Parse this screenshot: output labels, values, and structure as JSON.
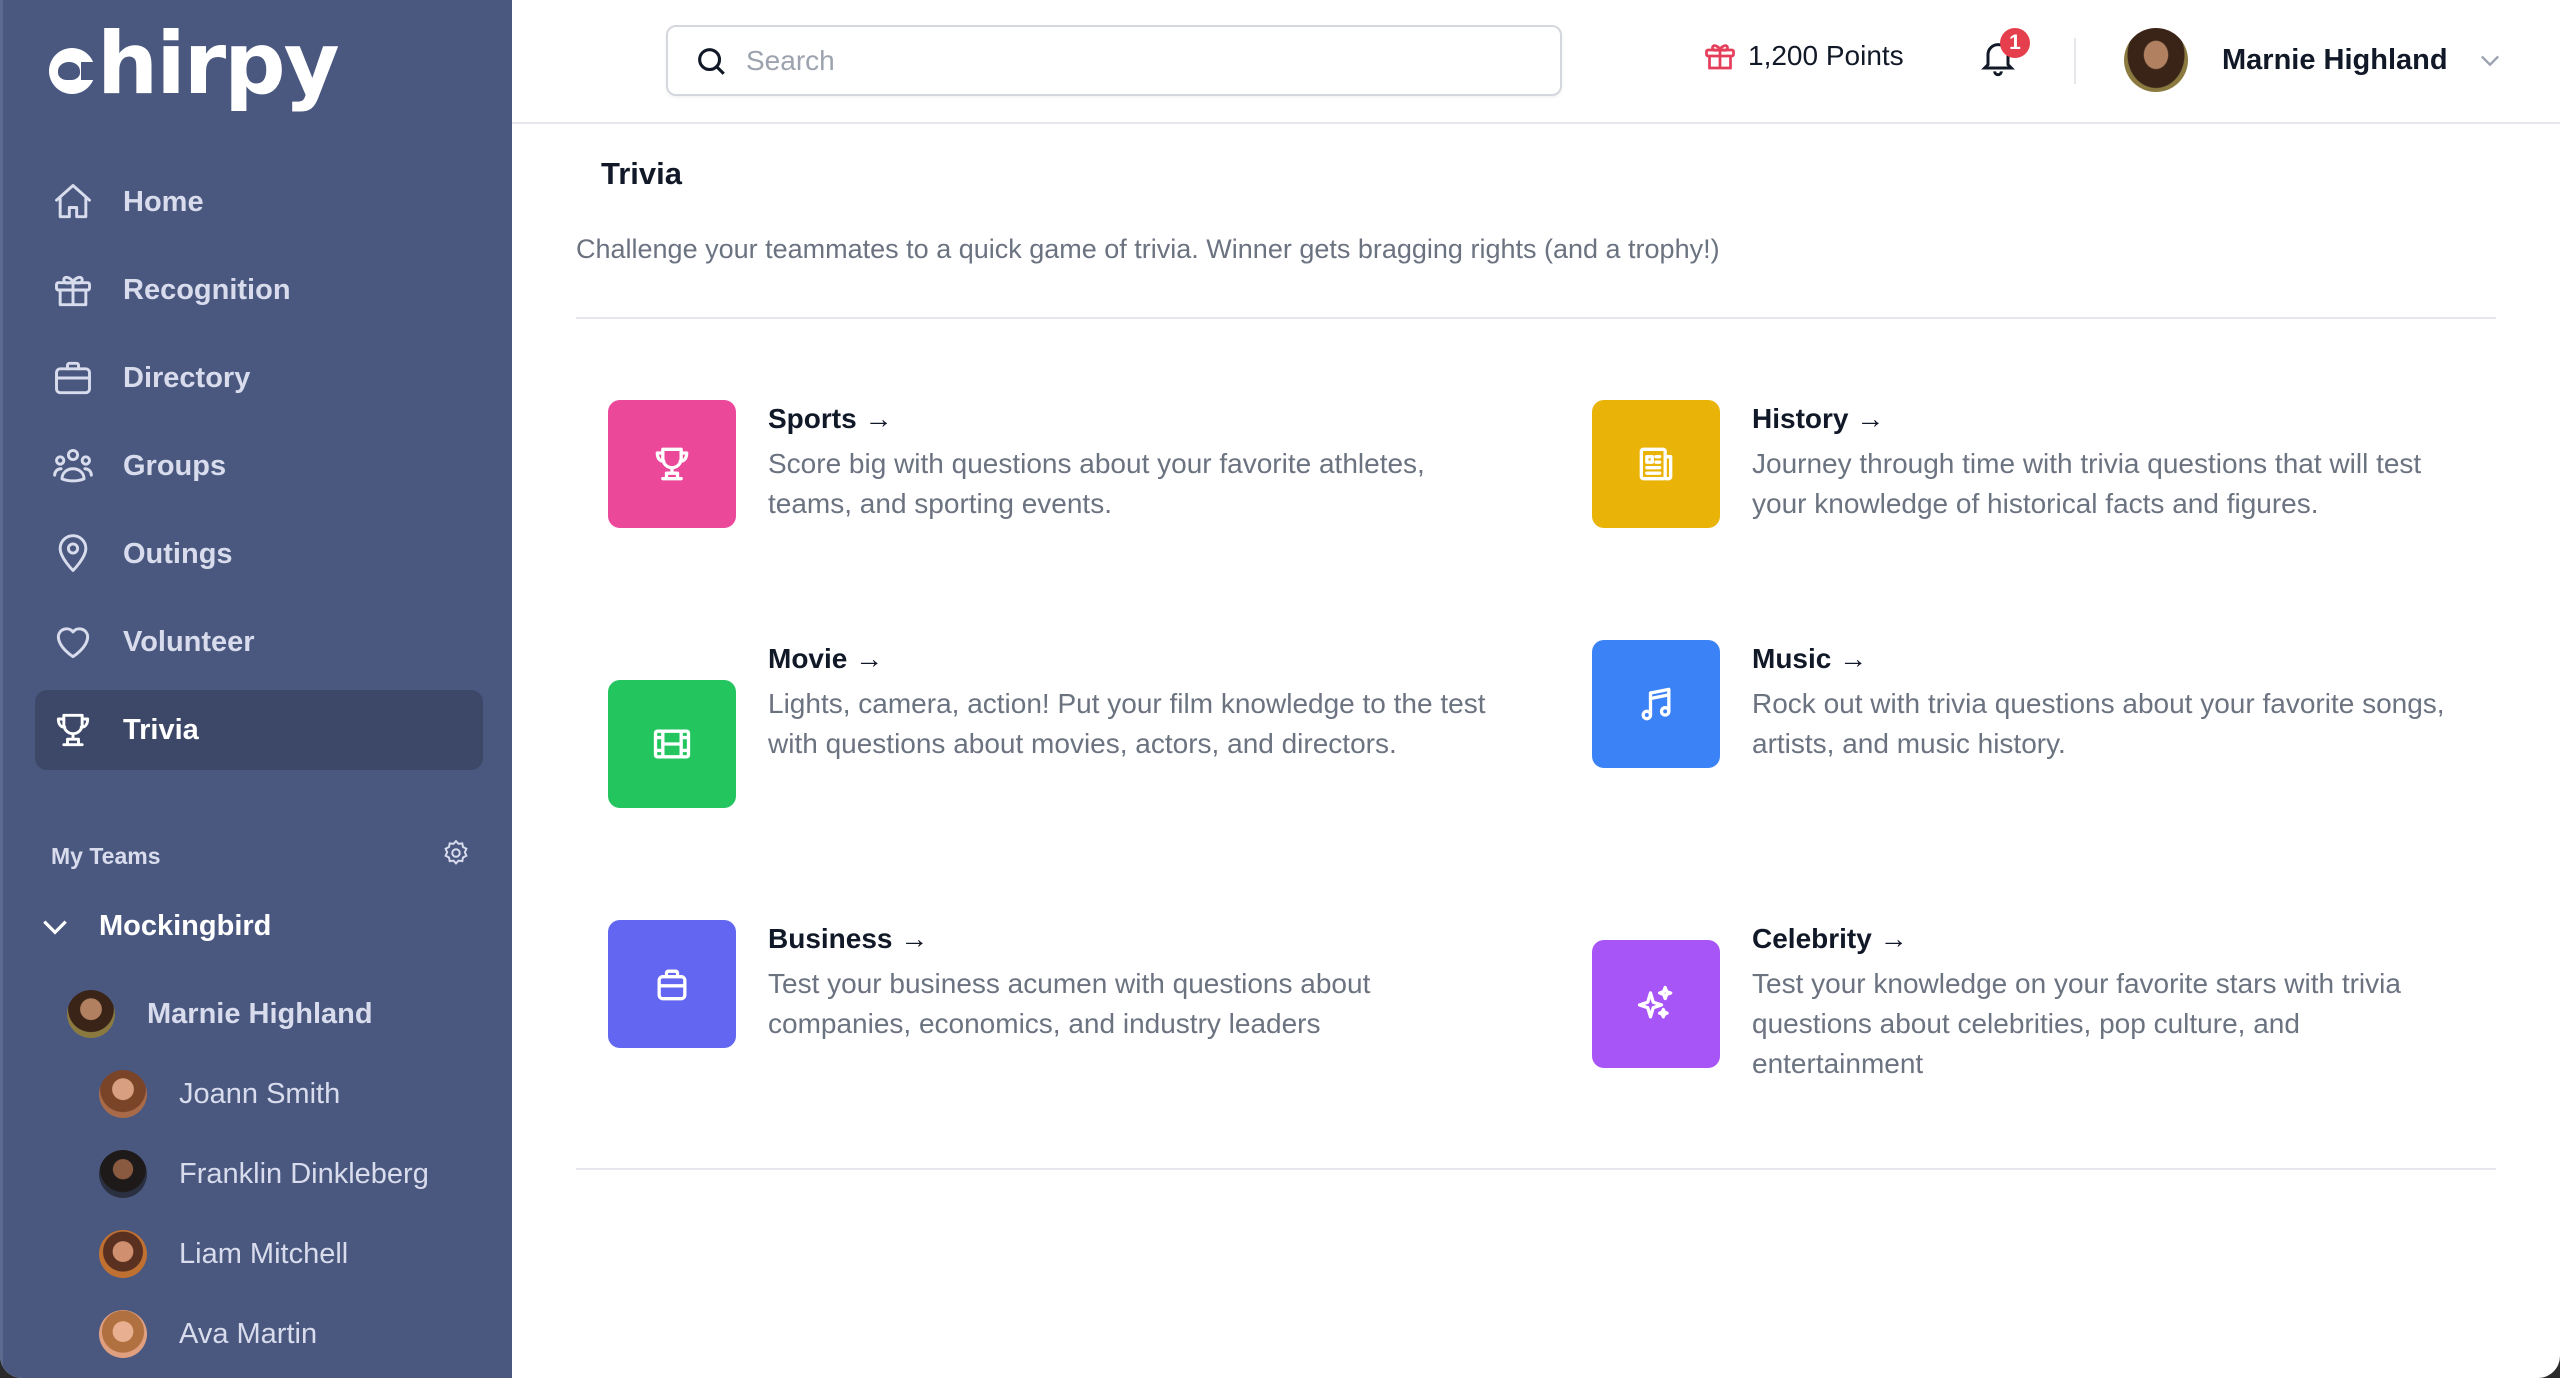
{
  "app": {
    "logo_text": "hirpy",
    "brand_color": "#4a5880"
  },
  "sidebar": {
    "nav": [
      {
        "label": "Home",
        "icon": "home-icon"
      },
      {
        "label": "Recognition",
        "icon": "gift-icon"
      },
      {
        "label": "Directory",
        "icon": "briefcase-icon"
      },
      {
        "label": "Groups",
        "icon": "users-icon"
      },
      {
        "label": "Outings",
        "icon": "map-pin-icon"
      },
      {
        "label": "Volunteer",
        "icon": "heart-icon"
      },
      {
        "label": "Trivia",
        "icon": "trophy-icon",
        "active": true
      }
    ],
    "teams_label": "My Teams",
    "team": {
      "name": "Mockingbird",
      "lead": "Marnie Highland",
      "members": [
        "Joann Smith",
        "Franklin Dinkleberg",
        "Liam Mitchell",
        "Ava Martin"
      ]
    }
  },
  "header": {
    "search_placeholder": "Search",
    "search_value": "",
    "points": "1,200 Points",
    "notification_count": "1",
    "user_name": "Marnie Highland"
  },
  "main": {
    "title": "Trivia",
    "subtitle": "Challenge your teammates to a quick game of trivia. Winner gets bragging rights (and a trophy!)",
    "categories": [
      {
        "title": "Sports →",
        "description": "Score big with questions about your favorite athletes, teams, and sporting events.",
        "color": "#ec4899",
        "icon": "trophy-icon"
      },
      {
        "title": "History →",
        "description": "Journey through time with trivia questions that will test your knowledge of historical facts and figures.",
        "color": "#eab308",
        "icon": "newspaper-icon"
      },
      {
        "title": "Movie →",
        "description": "Lights, camera, action! Put your film knowledge to the test with questions about movies, actors, and directors.",
        "color": "#22c55e",
        "icon": "film-icon"
      },
      {
        "title": "Music →",
        "description": "Rock out with trivia questions about your favorite songs, artists, and music history.",
        "color": "#3b82f6",
        "icon": "music-note-icon"
      },
      {
        "title": "Business →",
        "description": "Test your business acumen with questions about companies, economics, and industry leaders",
        "color": "#6366f1",
        "icon": "briefcase-icon"
      },
      {
        "title": "Celebrity →",
        "description": "Test your knowledge on your favorite stars with trivia questions about celebrities, pop culture, and entertainment",
        "color": "#a855f7",
        "icon": "sparkles-icon"
      }
    ]
  }
}
